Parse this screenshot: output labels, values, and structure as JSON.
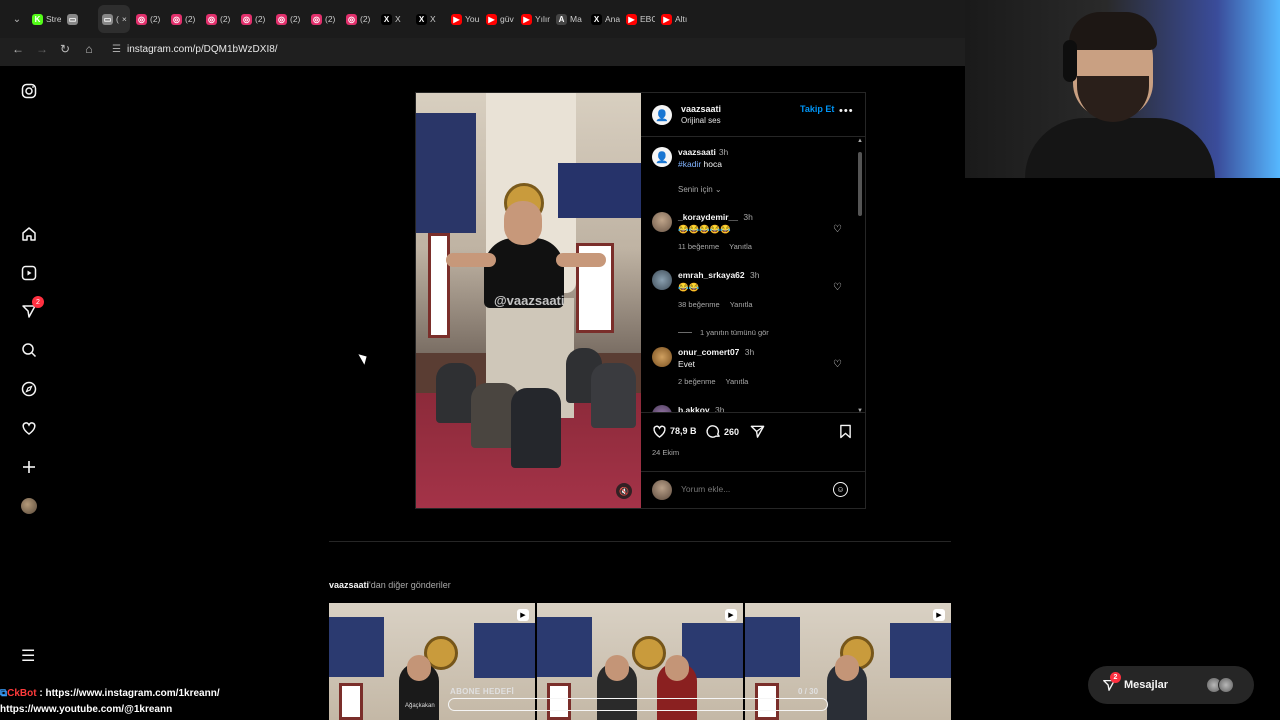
{
  "browser": {
    "tabs": [
      {
        "label": "Stre",
        "icon": "kick-icon",
        "color": "#53fc18"
      },
      {
        "label": "",
        "icon": "window-icon",
        "color": "#888888"
      },
      {
        "label": "(",
        "icon": "window-icon",
        "color": "#888888",
        "active": true
      },
      {
        "label": "(2)",
        "icon": "instagram-icon",
        "color": "#e1306c"
      },
      {
        "label": "(2)",
        "icon": "instagram-icon",
        "color": "#e1306c"
      },
      {
        "label": "(2)",
        "icon": "instagram-icon",
        "color": "#e1306c"
      },
      {
        "label": "(2)",
        "icon": "instagram-icon",
        "color": "#e1306c"
      },
      {
        "label": "(2)",
        "icon": "instagram-icon",
        "color": "#e1306c"
      },
      {
        "label": "(2)",
        "icon": "instagram-icon",
        "color": "#e1306c"
      },
      {
        "label": "(2)",
        "icon": "instagram-icon",
        "color": "#e1306c"
      },
      {
        "label": "X",
        "icon": "x-icon",
        "color": "#000000"
      },
      {
        "label": "X",
        "icon": "x-icon",
        "color": "#000000"
      },
      {
        "label": "You",
        "icon": "youtube-icon",
        "color": "#ff0000"
      },
      {
        "label": "güv",
        "icon": "youtube-icon",
        "color": "#ff0000"
      },
      {
        "label": "Yılın",
        "icon": "youtube-icon",
        "color": "#ff0000"
      },
      {
        "label": "Ma",
        "icon": "a-icon",
        "color": "#444444"
      },
      {
        "label": "Ana",
        "icon": "x-icon",
        "color": "#000000"
      },
      {
        "label": "EBC",
        "icon": "youtube-icon",
        "color": "#ff0000"
      },
      {
        "label": "Altı",
        "icon": "youtube-icon",
        "color": "#ff0000"
      }
    ],
    "url": "instagram.com/p/DQM1bWzDXI8/"
  },
  "post": {
    "username": "vaazsaati",
    "audio": "Orijinal ses",
    "follow_label": "Takip Et",
    "more_label": "•••",
    "watermark": "@vaazsaati",
    "caption": {
      "username": "vaazsaati",
      "time": "3h",
      "hashtag": "#kadir",
      "text": " hoca"
    },
    "for_you": "Senin için ⌄",
    "comments": [
      {
        "user": "_koraydemir__",
        "time": "3h",
        "text": "😂😂😂😂😂",
        "likes": "11 beğenme",
        "reply": "Yanıtla"
      },
      {
        "user": "emrah_srkaya62",
        "time": "3h",
        "text": "😂😂",
        "likes": "38 beğenme",
        "reply": "Yanıtla"
      },
      {
        "user": "onur_comert07",
        "time": "3h",
        "text": "Evet",
        "likes": "2 beğenme",
        "reply": "Yanıtla"
      },
      {
        "user": "b.akkoy",
        "time": "3h",
        "text": "",
        "likes": "",
        "reply": ""
      }
    ],
    "view_replies": "1 yanıtın tümünü gör",
    "likes_count": "78,9 B",
    "comments_count": "260",
    "date": "24 Ekim",
    "comment_placeholder": "Yorum ekle..."
  },
  "more_posts": {
    "username": "vaazsaati",
    "suffix": "'dan diğer gönderiler"
  },
  "overlay": {
    "progress_label": "ABONE HEDEFİ",
    "progress_count": "0 / 30",
    "progress_value": 0,
    "name_tag": "Ağaçkakan",
    "chat_bot": "CkBot",
    "chat_line1": " : https://www.instagram.com/1kreann/",
    "chat_line2": "https://www.youtube.com/@1kreann"
  },
  "messages": {
    "label": "Mesajlar",
    "badge": "2"
  },
  "sidebar": {
    "notification_badge": "2"
  }
}
